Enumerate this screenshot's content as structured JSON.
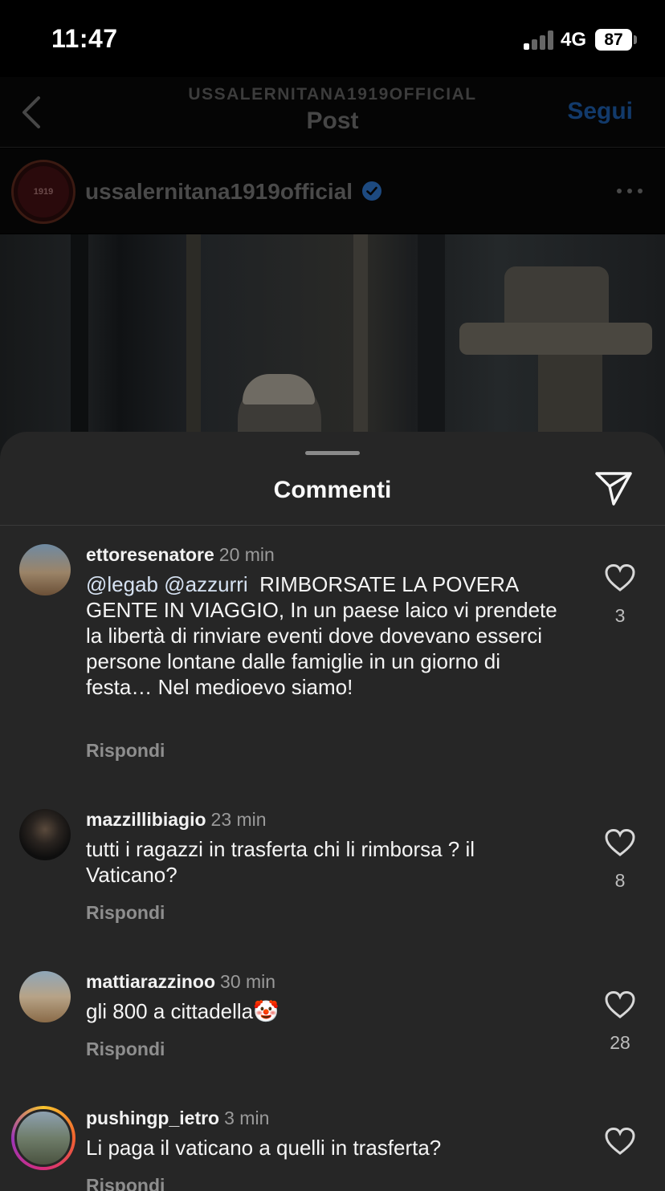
{
  "status_bar": {
    "time": "11:47",
    "network": "4G",
    "battery": "87"
  },
  "header": {
    "account": "USSALERNITANA1919OFFICIAL",
    "title": "Post",
    "follow_label": "Segui"
  },
  "post": {
    "author": "ussalernitana1919official",
    "avatar_text": "1919"
  },
  "comments_sheet": {
    "title": "Commenti",
    "comments": [
      {
        "username": "ettoresenatore",
        "time": "20 min",
        "mention_1": "@legab",
        "mention_2": "@azzurri",
        "text": "  RIMBORSATE LA POVERA GENTE IN VIAGGIO, In un paese laico vi prendete la libertà di rinviare eventi dove dovevano esserci persone lontane dalle famiglie in un giorno di festa… Nel medioevo siamo!",
        "reply_label": "Rispondi",
        "likes": "3"
      },
      {
        "username": "mazzillibiagio",
        "time": "23 min",
        "text": "tutti i ragazzi in trasferta chi li rimborsa ? il Vaticano?",
        "reply_label": "Rispondi",
        "likes": "8"
      },
      {
        "username": "mattiarazzinoo",
        "time": "30 min",
        "text": "gli 800 a cittadella🤡",
        "reply_label": "Rispondi",
        "likes": "28"
      },
      {
        "username": "pushingp_ietro",
        "time": "3 min",
        "text": "Li paga il vaticano a quelli in trasferta?",
        "reply_label": "Rispondi",
        "likes": ""
      }
    ]
  },
  "colors": {
    "sheet_bg": "#262626",
    "mention": "#d6e2f2",
    "verified": "#1d4a80",
    "follow_dimmed": "#123a6b"
  },
  "icons": [
    "back-chevron-icon",
    "verified-badge-icon",
    "more-options-icon",
    "share-send-icon",
    "heart-icon",
    "signal-icon",
    "battery-icon"
  ]
}
